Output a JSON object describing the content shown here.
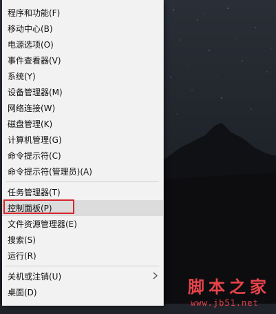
{
  "menu": {
    "items": [
      {
        "label": "程序和功能(F)"
      },
      {
        "label": "移动中心(B)"
      },
      {
        "label": "电源选项(O)"
      },
      {
        "label": "事件查看器(V)"
      },
      {
        "label": "系统(Y)"
      },
      {
        "label": "设备管理器(M)"
      },
      {
        "label": "网络连接(W)"
      },
      {
        "label": "磁盘管理(K)"
      },
      {
        "label": "计算机管理(G)"
      },
      {
        "label": "命令提示符(C)"
      },
      {
        "label": "命令提示符(管理员)(A)"
      },
      {
        "label": "任务管理器(T)"
      },
      {
        "label": "控制面板(P)"
      },
      {
        "label": "文件资源管理器(E)"
      },
      {
        "label": "搜索(S)"
      },
      {
        "label": "运行(R)"
      },
      {
        "label": "关机或注销(U)"
      },
      {
        "label": "桌面(D)"
      }
    ],
    "submenu_icon": "chevron-right-icon",
    "highlight_color": "#dcdcdc",
    "callout_color": "#d6262d"
  },
  "watermark": {
    "title": "脚本之家",
    "url": "www.jb51.net",
    "color": "#e8434a"
  }
}
